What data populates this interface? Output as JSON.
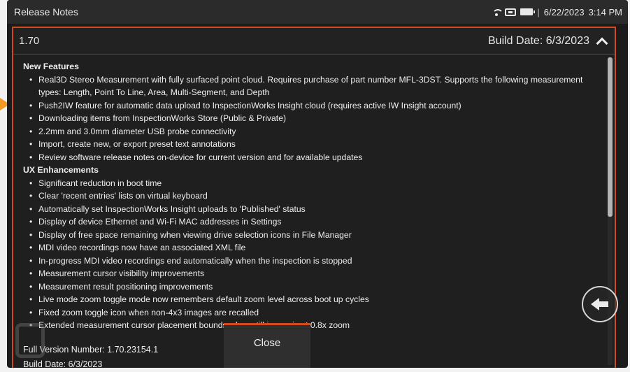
{
  "status_bar": {
    "title": "Release Notes",
    "date": "6/22/2023",
    "time": "3:14 PM",
    "divider": "|",
    "icons": [
      "wifi-icon",
      "usb-icon",
      "battery-icon"
    ]
  },
  "header": {
    "version": "1.70",
    "build_date": "Build Date: 6/3/2023"
  },
  "sections": {
    "new_features": {
      "title": "New Features",
      "items": [
        "Real3D Stereo Measurement with fully surfaced point cloud. Requires purchase of part number MFL-3DST. Supports the following measurement types: Length, Point To Line, Area, Multi-Segment, and Depth",
        "Push2IW feature for automatic data upload to InspectionWorks Insight cloud (requires active IW Insight account)",
        "Downloading items from InspectionWorks Store (Public & Private)",
        "2.2mm and 3.0mm diameter USB probe connectivity",
        "Import, create new, or export preset text annotations",
        "Review software release notes on-device for current version and for available updates"
      ]
    },
    "ux_enhancements": {
      "title": "UX Enhancements",
      "items": [
        "Significant reduction in boot time",
        "Clear 'recent entries' lists on virtual keyboard",
        "Automatically set InspectionWorks Insight uploads to 'Published' status",
        "Display of device Ethernet and Wi-Fi MAC addresses in Settings",
        "Display of free space remaining when viewing drive selection icons in File Manager",
        "MDI video recordings now have an associated XML file",
        "In-progress MDI video recordings end automatically when the inspection is stopped",
        "Measurement cursor visibility improvements",
        "Measurement result positioning improvements",
        "Live mode zoom toggle mode now remembers default zoom level across boot up cycles",
        "Fixed zoom toggle icon when non-4x3 images are recalled",
        "Extended measurement cursor placement bounds when still image is at 0.8x zoom"
      ]
    }
  },
  "footer": {
    "full_version": "Full Version Number: 1.70.23154.1",
    "build_date": "Build Date: 6/3/2023"
  },
  "buttons": {
    "close_label": "Close"
  },
  "colors": {
    "accent": "#d44a20",
    "annotation_arrow": "#f39a24",
    "background": "#1f1f1f"
  }
}
